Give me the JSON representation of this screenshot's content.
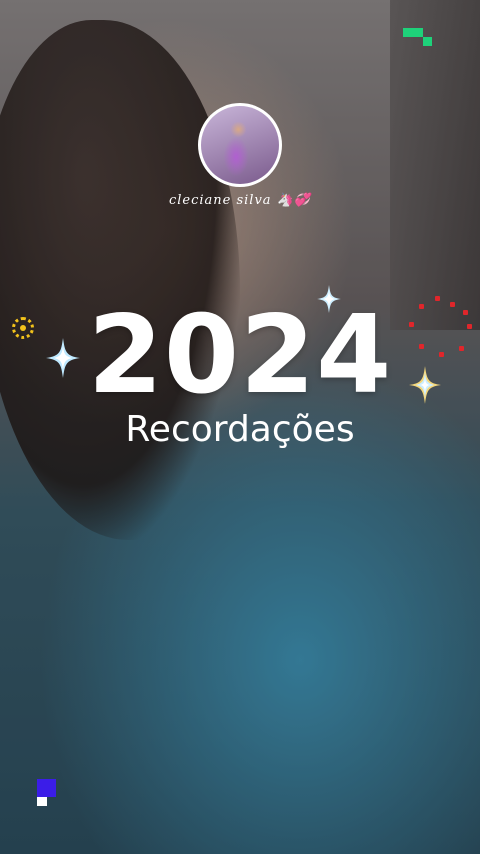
{
  "story": {
    "username": "cleciane silva 🦄💞",
    "year": "2024",
    "subtitle": "Recordações"
  },
  "colors": {
    "accent_green": "#1ed27a",
    "accent_yellow": "#f2c21b",
    "accent_red": "#e0262b",
    "accent_indigo": "#3b1de8"
  }
}
